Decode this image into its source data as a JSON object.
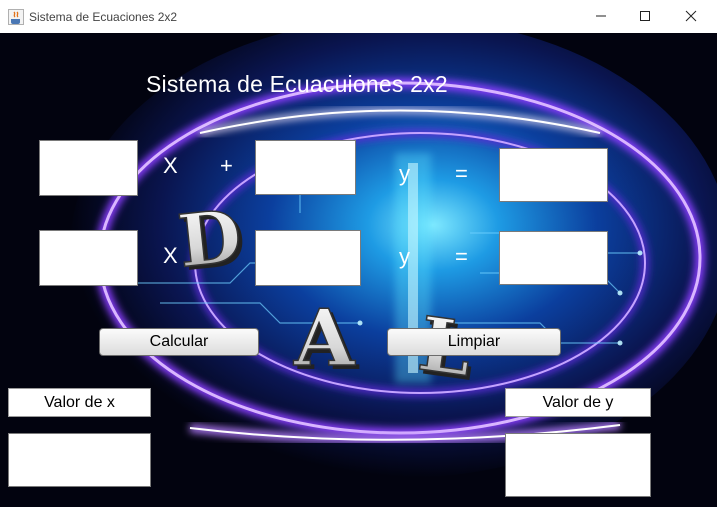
{
  "window": {
    "title": "Sistema de Ecuaciones 2x2",
    "icons": [
      "java-app-icon",
      "minimize-icon",
      "maximize-icon",
      "close-icon"
    ]
  },
  "form": {
    "heading": "Sistema de Ecuacuiones 2x2",
    "row1": {
      "x_symbol": "X",
      "plus_symbol": "+",
      "y_symbol": "y",
      "equals_symbol": "="
    },
    "row2": {
      "x_symbol": "X",
      "y_symbol": "y",
      "equals_symbol": "="
    },
    "buttons": {
      "calculate": "Calcular",
      "clear": "Limpiar"
    },
    "results": {
      "x_label": "Valor de x",
      "y_label": "Valor de y"
    },
    "background_logo": [
      "D",
      "A",
      "L"
    ]
  },
  "colors": {
    "background": "#02030f",
    "neon_purple": "#8a3cff",
    "neon_cyan": "#3fd8ff",
    "text": "#ffffff"
  }
}
